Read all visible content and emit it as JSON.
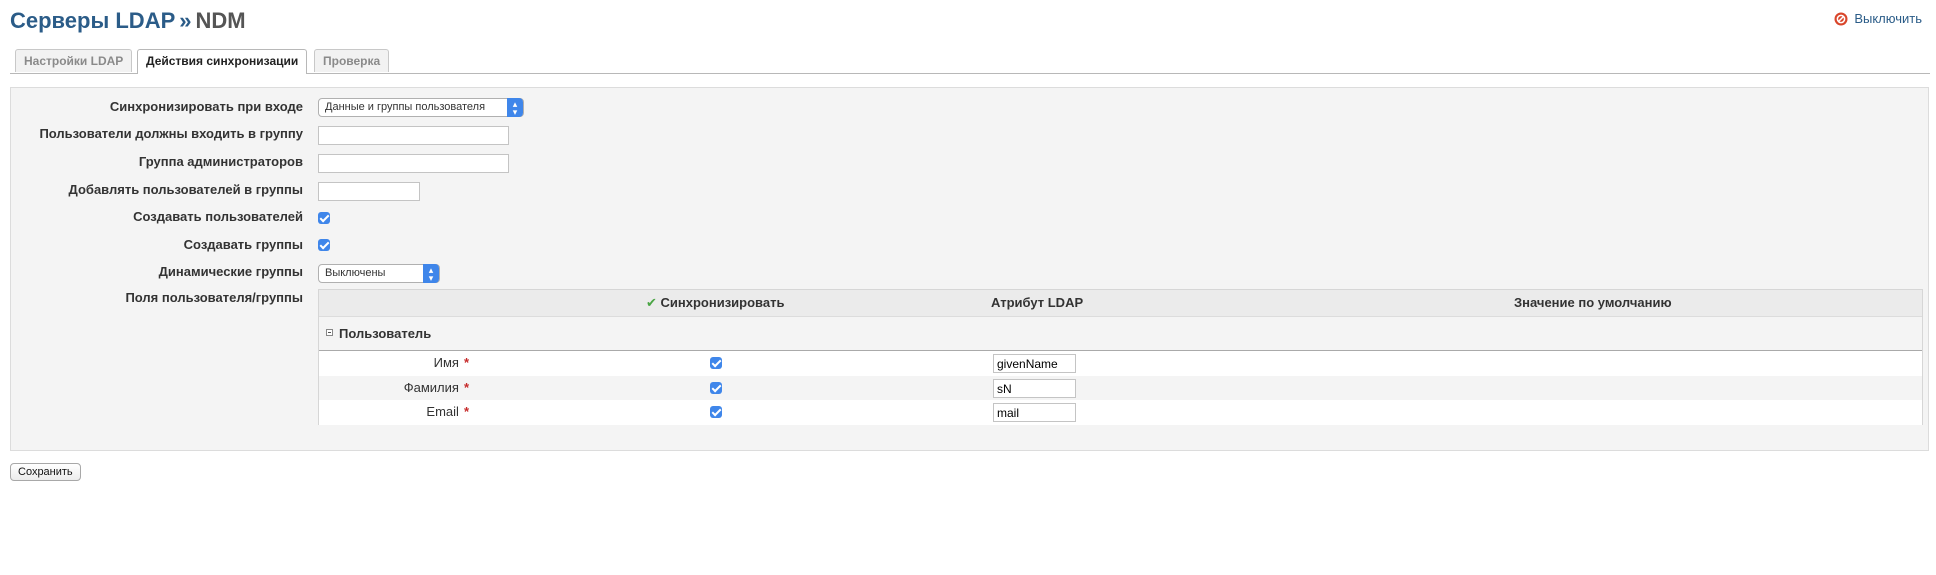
{
  "header": {
    "crumb_link": "Серверы LDAP",
    "separator": "»",
    "crumb_current": "NDM",
    "logout_label": "Выключить"
  },
  "tabs": [
    {
      "label": "Настройки LDAP",
      "active": false
    },
    {
      "label": "Действия синхронизации",
      "active": true
    },
    {
      "label": "Проверка",
      "active": false
    }
  ],
  "form": {
    "sync_on_login": {
      "label": "Синхронизировать при входе",
      "value": "Данные и группы пользователя"
    },
    "must_be_in_group": {
      "label": "Пользователи должны входить в группу",
      "value": ""
    },
    "admin_group": {
      "label": "Группа администраторов",
      "value": ""
    },
    "add_to_groups": {
      "label": "Добавлять пользователей в группы",
      "value": ""
    },
    "create_users": {
      "label": "Создавать пользователей",
      "checked": true
    },
    "create_groups": {
      "label": "Создавать группы",
      "checked": true
    },
    "dynamic_groups": {
      "label": "Динамические группы",
      "value": "Выключены"
    },
    "fields_label": "Поля пользователя/группы"
  },
  "attr_table": {
    "headers": {
      "sync": "Синхронизировать",
      "ldap_attr": "Атрибут LDAP",
      "default_value": "Значение по умолчанию"
    },
    "group_label": "Пользователь",
    "required_mark": "*",
    "rows": [
      {
        "label": "Имя",
        "required": true,
        "sync": true,
        "ldap_attr": "givenName",
        "default": ""
      },
      {
        "label": "Фамилия",
        "required": true,
        "sync": true,
        "ldap_attr": "sN",
        "default": ""
      },
      {
        "label": "Email",
        "required": true,
        "sync": true,
        "ldap_attr": "mail",
        "default": ""
      }
    ]
  },
  "save_label": "Сохранить",
  "colors": {
    "link": "#2b5c88",
    "accent": "#3f86ea",
    "required": "#c62a2a",
    "check_green": "#4aa544",
    "logout_red": "#d9462b"
  }
}
